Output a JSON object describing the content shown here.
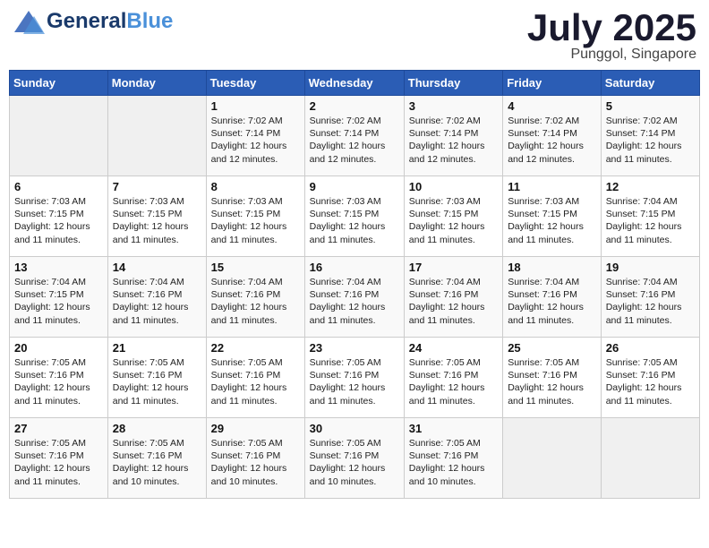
{
  "header": {
    "logo_main": "General",
    "logo_accent": "Blue",
    "month": "July 2025",
    "location": "Punggol, Singapore"
  },
  "weekdays": [
    "Sunday",
    "Monday",
    "Tuesday",
    "Wednesday",
    "Thursday",
    "Friday",
    "Saturday"
  ],
  "weeks": [
    [
      {
        "day": "",
        "info": ""
      },
      {
        "day": "",
        "info": ""
      },
      {
        "day": "1",
        "info": "Sunrise: 7:02 AM\nSunset: 7:14 PM\nDaylight: 12 hours\nand 12 minutes."
      },
      {
        "day": "2",
        "info": "Sunrise: 7:02 AM\nSunset: 7:14 PM\nDaylight: 12 hours\nand 12 minutes."
      },
      {
        "day": "3",
        "info": "Sunrise: 7:02 AM\nSunset: 7:14 PM\nDaylight: 12 hours\nand 12 minutes."
      },
      {
        "day": "4",
        "info": "Sunrise: 7:02 AM\nSunset: 7:14 PM\nDaylight: 12 hours\nand 12 minutes."
      },
      {
        "day": "5",
        "info": "Sunrise: 7:02 AM\nSunset: 7:14 PM\nDaylight: 12 hours\nand 11 minutes."
      }
    ],
    [
      {
        "day": "6",
        "info": "Sunrise: 7:03 AM\nSunset: 7:15 PM\nDaylight: 12 hours\nand 11 minutes."
      },
      {
        "day": "7",
        "info": "Sunrise: 7:03 AM\nSunset: 7:15 PM\nDaylight: 12 hours\nand 11 minutes."
      },
      {
        "day": "8",
        "info": "Sunrise: 7:03 AM\nSunset: 7:15 PM\nDaylight: 12 hours\nand 11 minutes."
      },
      {
        "day": "9",
        "info": "Sunrise: 7:03 AM\nSunset: 7:15 PM\nDaylight: 12 hours\nand 11 minutes."
      },
      {
        "day": "10",
        "info": "Sunrise: 7:03 AM\nSunset: 7:15 PM\nDaylight: 12 hours\nand 11 minutes."
      },
      {
        "day": "11",
        "info": "Sunrise: 7:03 AM\nSunset: 7:15 PM\nDaylight: 12 hours\nand 11 minutes."
      },
      {
        "day": "12",
        "info": "Sunrise: 7:04 AM\nSunset: 7:15 PM\nDaylight: 12 hours\nand 11 minutes."
      }
    ],
    [
      {
        "day": "13",
        "info": "Sunrise: 7:04 AM\nSunset: 7:15 PM\nDaylight: 12 hours\nand 11 minutes."
      },
      {
        "day": "14",
        "info": "Sunrise: 7:04 AM\nSunset: 7:16 PM\nDaylight: 12 hours\nand 11 minutes."
      },
      {
        "day": "15",
        "info": "Sunrise: 7:04 AM\nSunset: 7:16 PM\nDaylight: 12 hours\nand 11 minutes."
      },
      {
        "day": "16",
        "info": "Sunrise: 7:04 AM\nSunset: 7:16 PM\nDaylight: 12 hours\nand 11 minutes."
      },
      {
        "day": "17",
        "info": "Sunrise: 7:04 AM\nSunset: 7:16 PM\nDaylight: 12 hours\nand 11 minutes."
      },
      {
        "day": "18",
        "info": "Sunrise: 7:04 AM\nSunset: 7:16 PM\nDaylight: 12 hours\nand 11 minutes."
      },
      {
        "day": "19",
        "info": "Sunrise: 7:04 AM\nSunset: 7:16 PM\nDaylight: 12 hours\nand 11 minutes."
      }
    ],
    [
      {
        "day": "20",
        "info": "Sunrise: 7:05 AM\nSunset: 7:16 PM\nDaylight: 12 hours\nand 11 minutes."
      },
      {
        "day": "21",
        "info": "Sunrise: 7:05 AM\nSunset: 7:16 PM\nDaylight: 12 hours\nand 11 minutes."
      },
      {
        "day": "22",
        "info": "Sunrise: 7:05 AM\nSunset: 7:16 PM\nDaylight: 12 hours\nand 11 minutes."
      },
      {
        "day": "23",
        "info": "Sunrise: 7:05 AM\nSunset: 7:16 PM\nDaylight: 12 hours\nand 11 minutes."
      },
      {
        "day": "24",
        "info": "Sunrise: 7:05 AM\nSunset: 7:16 PM\nDaylight: 12 hours\nand 11 minutes."
      },
      {
        "day": "25",
        "info": "Sunrise: 7:05 AM\nSunset: 7:16 PM\nDaylight: 12 hours\nand 11 minutes."
      },
      {
        "day": "26",
        "info": "Sunrise: 7:05 AM\nSunset: 7:16 PM\nDaylight: 12 hours\nand 11 minutes."
      }
    ],
    [
      {
        "day": "27",
        "info": "Sunrise: 7:05 AM\nSunset: 7:16 PM\nDaylight: 12 hours\nand 11 minutes."
      },
      {
        "day": "28",
        "info": "Sunrise: 7:05 AM\nSunset: 7:16 PM\nDaylight: 12 hours\nand 10 minutes."
      },
      {
        "day": "29",
        "info": "Sunrise: 7:05 AM\nSunset: 7:16 PM\nDaylight: 12 hours\nand 10 minutes."
      },
      {
        "day": "30",
        "info": "Sunrise: 7:05 AM\nSunset: 7:16 PM\nDaylight: 12 hours\nand 10 minutes."
      },
      {
        "day": "31",
        "info": "Sunrise: 7:05 AM\nSunset: 7:16 PM\nDaylight: 12 hours\nand 10 minutes."
      },
      {
        "day": "",
        "info": ""
      },
      {
        "day": "",
        "info": ""
      }
    ]
  ]
}
